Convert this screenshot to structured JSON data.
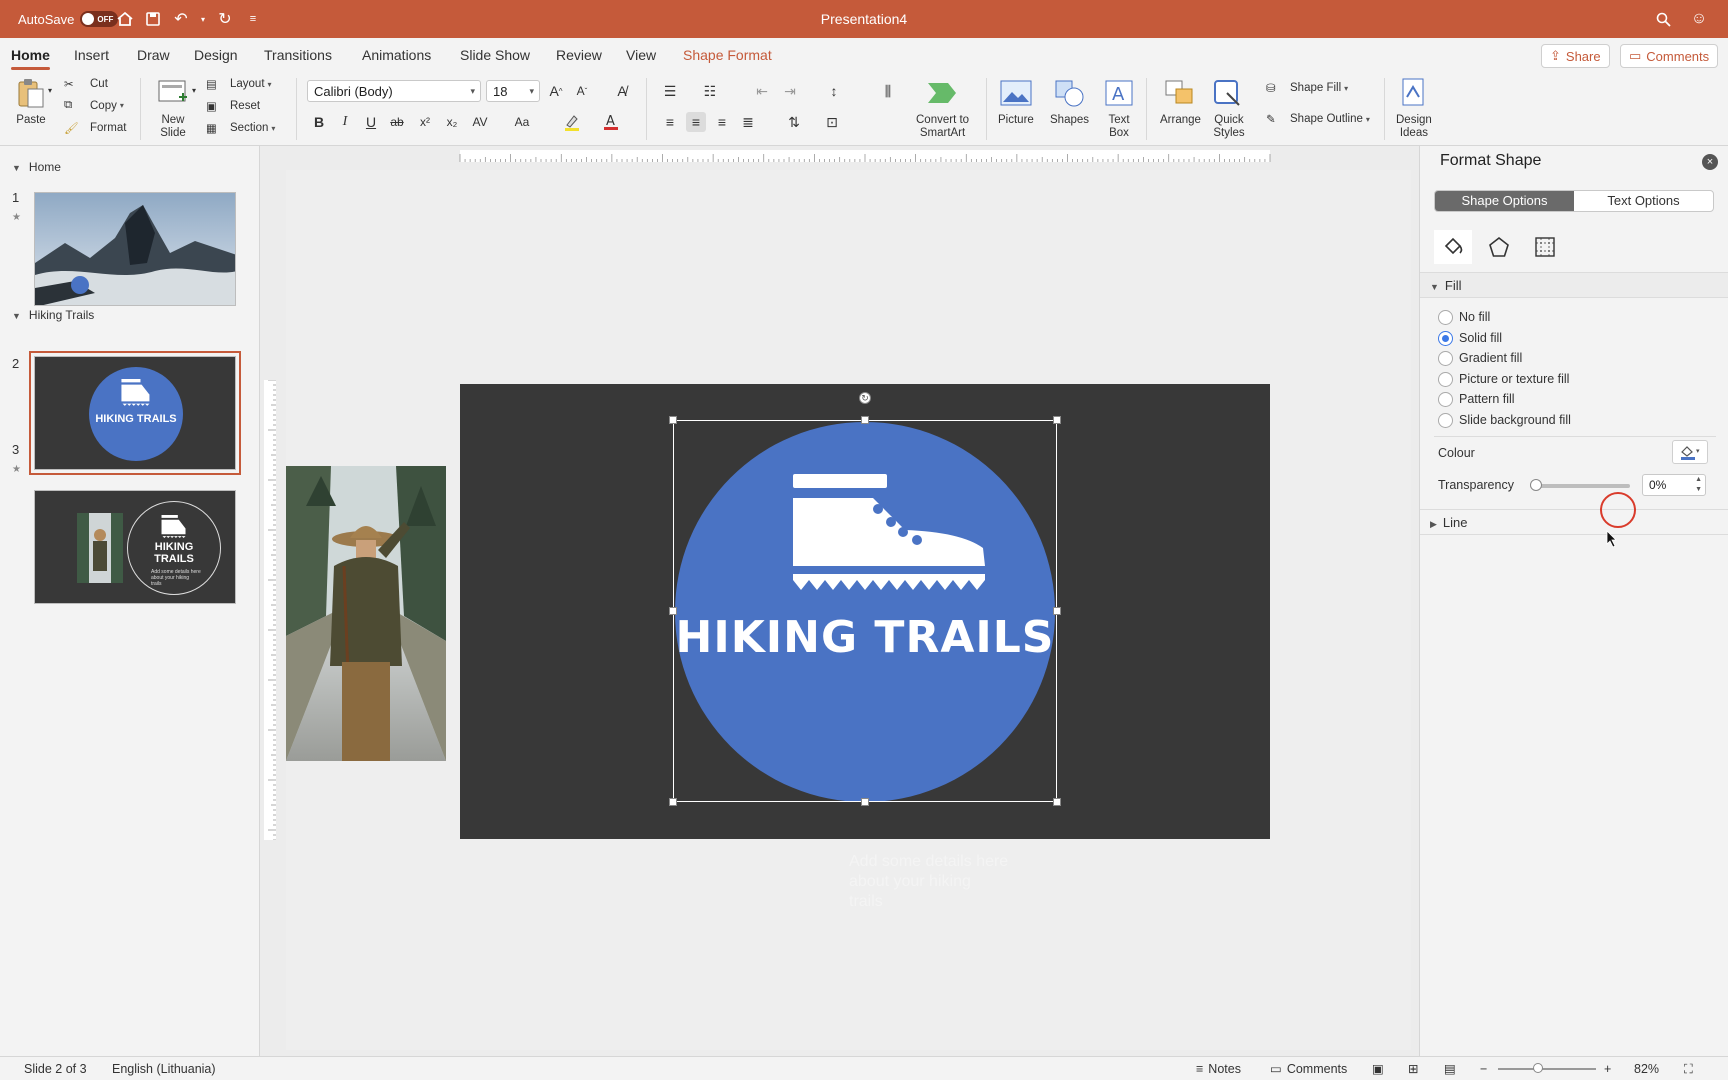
{
  "titlebar": {
    "autosave_label": "AutoSave",
    "autosave_state": "OFF",
    "doc_title": "Presentation4"
  },
  "tabs": [
    {
      "label": "Home"
    },
    {
      "label": "Insert"
    },
    {
      "label": "Draw"
    },
    {
      "label": "Design"
    },
    {
      "label": "Transitions"
    },
    {
      "label": "Animations"
    },
    {
      "label": "Slide Show"
    },
    {
      "label": "Review"
    },
    {
      "label": "View"
    },
    {
      "label": "Shape Format"
    }
  ],
  "share_label": "Share",
  "comments_label": "Comments",
  "ribbon": {
    "paste": "Paste",
    "cut": "Cut",
    "copy": "Copy",
    "format": "Format",
    "new_slide": "New\nSlide",
    "layout": "Layout",
    "reset": "Reset",
    "section": "Section",
    "font_name": "Calibri (Body)",
    "font_size": "18",
    "convert_smartart": "Convert to\nSmartArt",
    "picture": "Picture",
    "shapes": "Shapes",
    "text_box": "Text\nBox",
    "arrange": "Arrange",
    "quick_styles": "Quick\nStyles",
    "shape_fill": "Shape Fill",
    "shape_outline": "Shape Outline",
    "design_ideas": "Design\nIdeas"
  },
  "thumbs": {
    "section1": "Home",
    "section2": "Hiking Trails",
    "slide_nums": [
      "1",
      "2",
      "3"
    ],
    "thumb_title": "HIKING TRAILS",
    "thumb3_title_1": "HIKING",
    "thumb3_title_2": "TRAILS",
    "thumb3_sub": "Add some details here about your hiking trails"
  },
  "slide": {
    "title": "HIKING TRAILS",
    "notes_text": "Add some details here about your hiking trails",
    "circle_color": "#4a73c4",
    "bg_color": "#383838"
  },
  "pane": {
    "title": "Format Shape",
    "tab_shape": "Shape Options",
    "tab_text": "Text Options",
    "fill_header": "Fill",
    "fill_options": [
      {
        "label": "No fill",
        "checked": false
      },
      {
        "label": "Solid fill",
        "checked": true
      },
      {
        "label": "Gradient fill",
        "checked": false
      },
      {
        "label": "Picture or texture fill",
        "checked": false
      },
      {
        "label": "Pattern fill",
        "checked": false
      },
      {
        "label": "Slide background fill",
        "checked": false
      }
    ],
    "colour_label": "Colour",
    "transparency_label": "Transparency",
    "transparency_value": "0%",
    "line_header": "Line"
  },
  "status": {
    "slide_info": "Slide 2 of 3",
    "language": "English (Lithuania)",
    "notes": "Notes",
    "comments": "Comments",
    "zoom": "82%"
  },
  "colors": {
    "accent": "#c55a3a",
    "radio_checked": "#3b78e7"
  }
}
